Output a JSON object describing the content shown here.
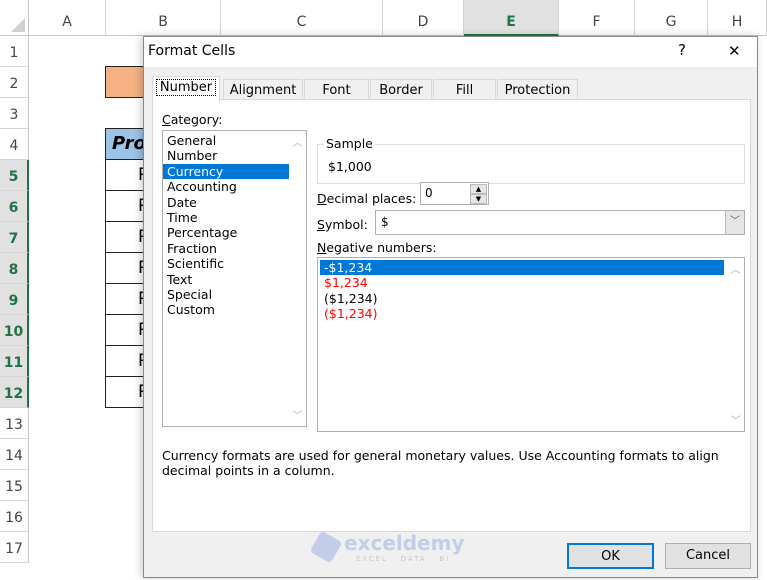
{
  "sheet": {
    "columns": [
      "A",
      "B",
      "C",
      "D",
      "E",
      "F",
      "G",
      "H"
    ],
    "selected_column": "E",
    "rows": [
      "1",
      "2",
      "3",
      "4",
      "5",
      "6",
      "7",
      "8",
      "9",
      "10",
      "11",
      "12",
      "13",
      "14",
      "15",
      "16",
      "17"
    ],
    "selected_rows": [
      "5",
      "6",
      "7",
      "8",
      "9",
      "10",
      "11",
      "12"
    ],
    "header_cell": "Pro",
    "body_cells": [
      "P",
      "P",
      "P",
      "P",
      "P",
      "P",
      "P",
      "P"
    ],
    "colors": {
      "orange": "#f4b183",
      "header_blue": "#9dc3e6",
      "accent": "#217346"
    }
  },
  "dialog": {
    "title": "Format Cells",
    "help": "?",
    "close": "✕",
    "tabs": [
      "Number",
      "Alignment",
      "Font",
      "Border",
      "Fill",
      "Protection"
    ],
    "active_tab": "Number",
    "category_label": "Category:",
    "categories": [
      "General",
      "Number",
      "Currency",
      "Accounting",
      "Date",
      "Time",
      "Percentage",
      "Fraction",
      "Scientific",
      "Text",
      "Special",
      "Custom"
    ],
    "selected_category": "Currency",
    "sample_label": "Sample",
    "sample_value": "$1,000",
    "decimal_label": "Decimal places:",
    "decimal_value": "0",
    "symbol_label": "Symbol:",
    "symbol_value": "$",
    "negative_label": "Negative numbers:",
    "negative_options": [
      {
        "text": "-$1,234",
        "color": "#ffffff",
        "selected": true
      },
      {
        "text": "$1,234",
        "color": "#ff0000"
      },
      {
        "text": "($1,234)",
        "color": "#000000"
      },
      {
        "text": "($1,234)",
        "color": "#ff0000"
      }
    ],
    "description": "Currency formats are used for general monetary values.  Use Accounting formats to align decimal points in a column.",
    "ok": "OK",
    "cancel": "Cancel",
    "watermark": {
      "name": "exceldemy",
      "tagline": "EXCEL · DATA · BI"
    }
  }
}
